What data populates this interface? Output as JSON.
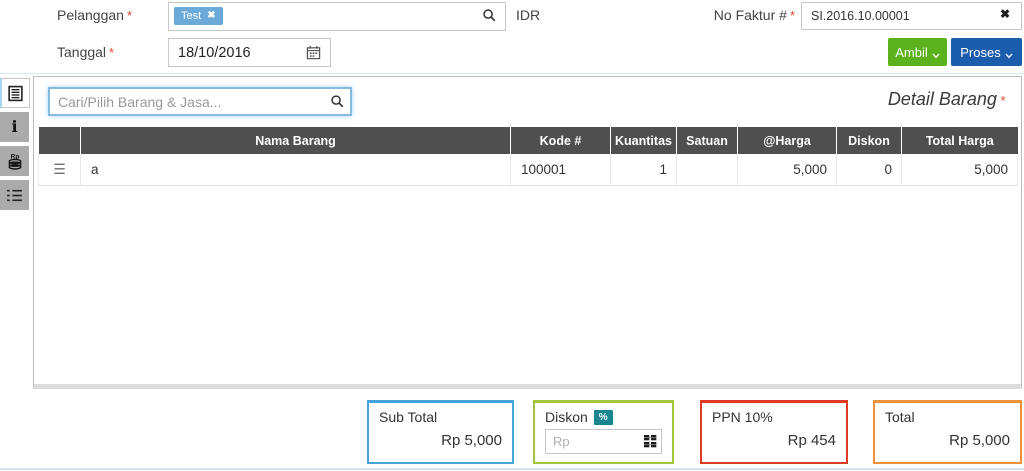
{
  "header_form": {
    "pelanggan_label": "Pelanggan",
    "required_mark": "*",
    "customer_tag": "Test",
    "currency_code": "IDR",
    "no_faktur_label": "No Faktur #",
    "no_faktur_value": "SI.2016.10.00001",
    "tanggal_label": "Tanggal",
    "tanggal_value": "18/10/2016",
    "ambil_button": "Ambil",
    "proses_button": "Proses",
    "ambil_color": "#5cb21d",
    "proses_color": "#1b5cad",
    "tag_color": "#6aa9d8"
  },
  "item_panel": {
    "search_placeholder": "Cari/Pilih Barang & Jasa...",
    "title": "Detail Barang"
  },
  "table": {
    "header_bg": "#4f4f4f",
    "headers": {
      "nama": "Nama Barang",
      "kode": "Kode #",
      "kuantitas": "Kuantitas",
      "satuan": "Satuan",
      "harga": "@Harga",
      "diskon": "Diskon",
      "total": "Total Harga"
    },
    "rows": [
      {
        "nama": "a",
        "kode": "100001",
        "kuantitas": "1",
        "satuan": "",
        "harga": "5,000",
        "diskon": "0",
        "total": "5,000"
      }
    ]
  },
  "summary": {
    "sub_total": {
      "label": "Sub Total",
      "value": "Rp 5,000",
      "border_color": "#45a4dc"
    },
    "diskon": {
      "label": "Diskon",
      "badge": "%",
      "badge_color": "#19858e",
      "input_placeholder": "Rp",
      "border_color": "#a2c33c"
    },
    "ppn": {
      "label": "PPN 10%",
      "value": "Rp 454",
      "border_color": "#dd3b24"
    },
    "total": {
      "label": "Total",
      "value": "Rp 5,000",
      "border_color": "#f0913c"
    }
  }
}
